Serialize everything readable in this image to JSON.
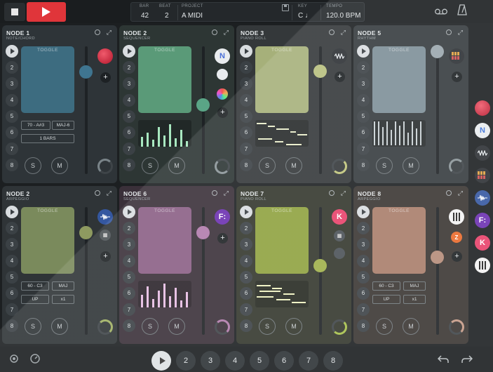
{
  "transport": {
    "bar_label": "BAR",
    "bar_value": "42",
    "beat_label": "BEAT",
    "beat_value": "2",
    "project_label": "PROJECT",
    "project_value": "A MIDI",
    "key_label": "KEY",
    "key_value": "C ♩",
    "tempo_label": "TEMPO",
    "tempo_value": "120.0 BPM"
  },
  "cards": [
    {
      "title": "NODE 1",
      "subtitle": "NOTE/CHORD",
      "pad": "TOGGLE",
      "pill_a": "70 - A#3",
      "pill_b": "MAJ-6",
      "pill_c": "1 BARS",
      "s": "S",
      "m": "M"
    },
    {
      "title": "NODE 2",
      "subtitle": "SEQUENCER",
      "pad": "TOGGLE",
      "s": "S",
      "m": "M",
      "inst_letter": "N"
    },
    {
      "title": "NODE 3",
      "subtitle": "PIANO ROLL",
      "pad": "TOGGLE",
      "s": "S",
      "m": "M"
    },
    {
      "title": "NODE 5",
      "subtitle": "RHYTHM",
      "pad": "TOGGLE",
      "s": "S",
      "m": "M"
    },
    {
      "title": "NODE 2",
      "subtitle": "ARPEGGIO",
      "pad": "TOGGLE",
      "pill_a": "60 - C3",
      "pill_b": "MAJ",
      "pill_c": "UP",
      "pill_d": "x1",
      "s": "S",
      "m": "M"
    },
    {
      "title": "NODE 6",
      "subtitle": "SEQUENCER",
      "pad": "TOGGLE",
      "s": "S",
      "m": "M",
      "inst_letter": "F:"
    },
    {
      "title": "NODE 7",
      "subtitle": "PIANO ROLL",
      "pad": "TOGGLE",
      "s": "S",
      "m": "M",
      "inst_letter": "K"
    },
    {
      "title": "NODE 8",
      "subtitle": "ARPEGGIO",
      "pad": "TOGGLE",
      "pill_a": "60 - C3",
      "pill_b": "MAJ",
      "pill_c": "UP",
      "pill_d": "x1",
      "s": "S",
      "m": "M",
      "inst_letter": "Z"
    }
  ],
  "steps": [
    "2",
    "3",
    "4",
    "5",
    "6",
    "7",
    "8"
  ],
  "rail": {
    "n_letter": "N",
    "f_letter": "F:",
    "k_letter": "K"
  },
  "colors": {
    "accent_red": "#e0353a",
    "pad_blue": "#3f6f82",
    "pad_green": "#5a9a78",
    "pad_olive": "#a6b07a",
    "pad_grey": "#7d8e97",
    "pad_purple": "#8a5f85",
    "pad_lime": "#8ea23f",
    "pad_peach": "#a87d6a"
  }
}
